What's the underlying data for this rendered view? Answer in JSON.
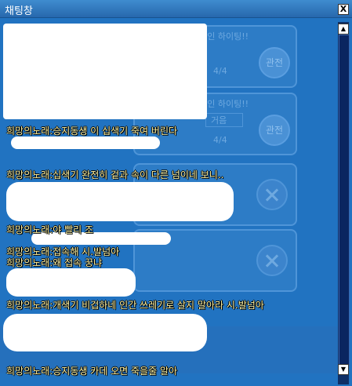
{
  "window": {
    "title": "채팅창",
    "close_label": "X"
  },
  "background": {
    "rooms": [
      {
        "title": "도라인 하이팅!!",
        "count": "4/4",
        "join_label": "관전"
      },
      {
        "title": "도라인 하이팅!!",
        "extra": "거음",
        "count": "4/4",
        "join_label": "관전"
      }
    ]
  },
  "chat": {
    "messages": [
      {
        "text": "희망의노래:승지동생 이 십색기 죽여 버린다"
      },
      {
        "text": "희망의노래:십색기 완전히  겉과 속이 다른 넘이네 보니.."
      },
      {
        "text": "희망의노래:야 빨리 조"
      },
      {
        "text": "희망의노래:접속해 시.발넘아"
      },
      {
        "text": "희망의노래:왜 접속 꿍냐"
      },
      {
        "text": "희망의노래:개색기 비겁하네 인간 쓰레기로 살지 말아라 시.발넘아"
      },
      {
        "text": "희망의노래:승지동생 카데 오면 죽을줄 알아"
      }
    ]
  },
  "scrollbar": {
    "up_icon": "▲",
    "down_icon": "▼"
  }
}
